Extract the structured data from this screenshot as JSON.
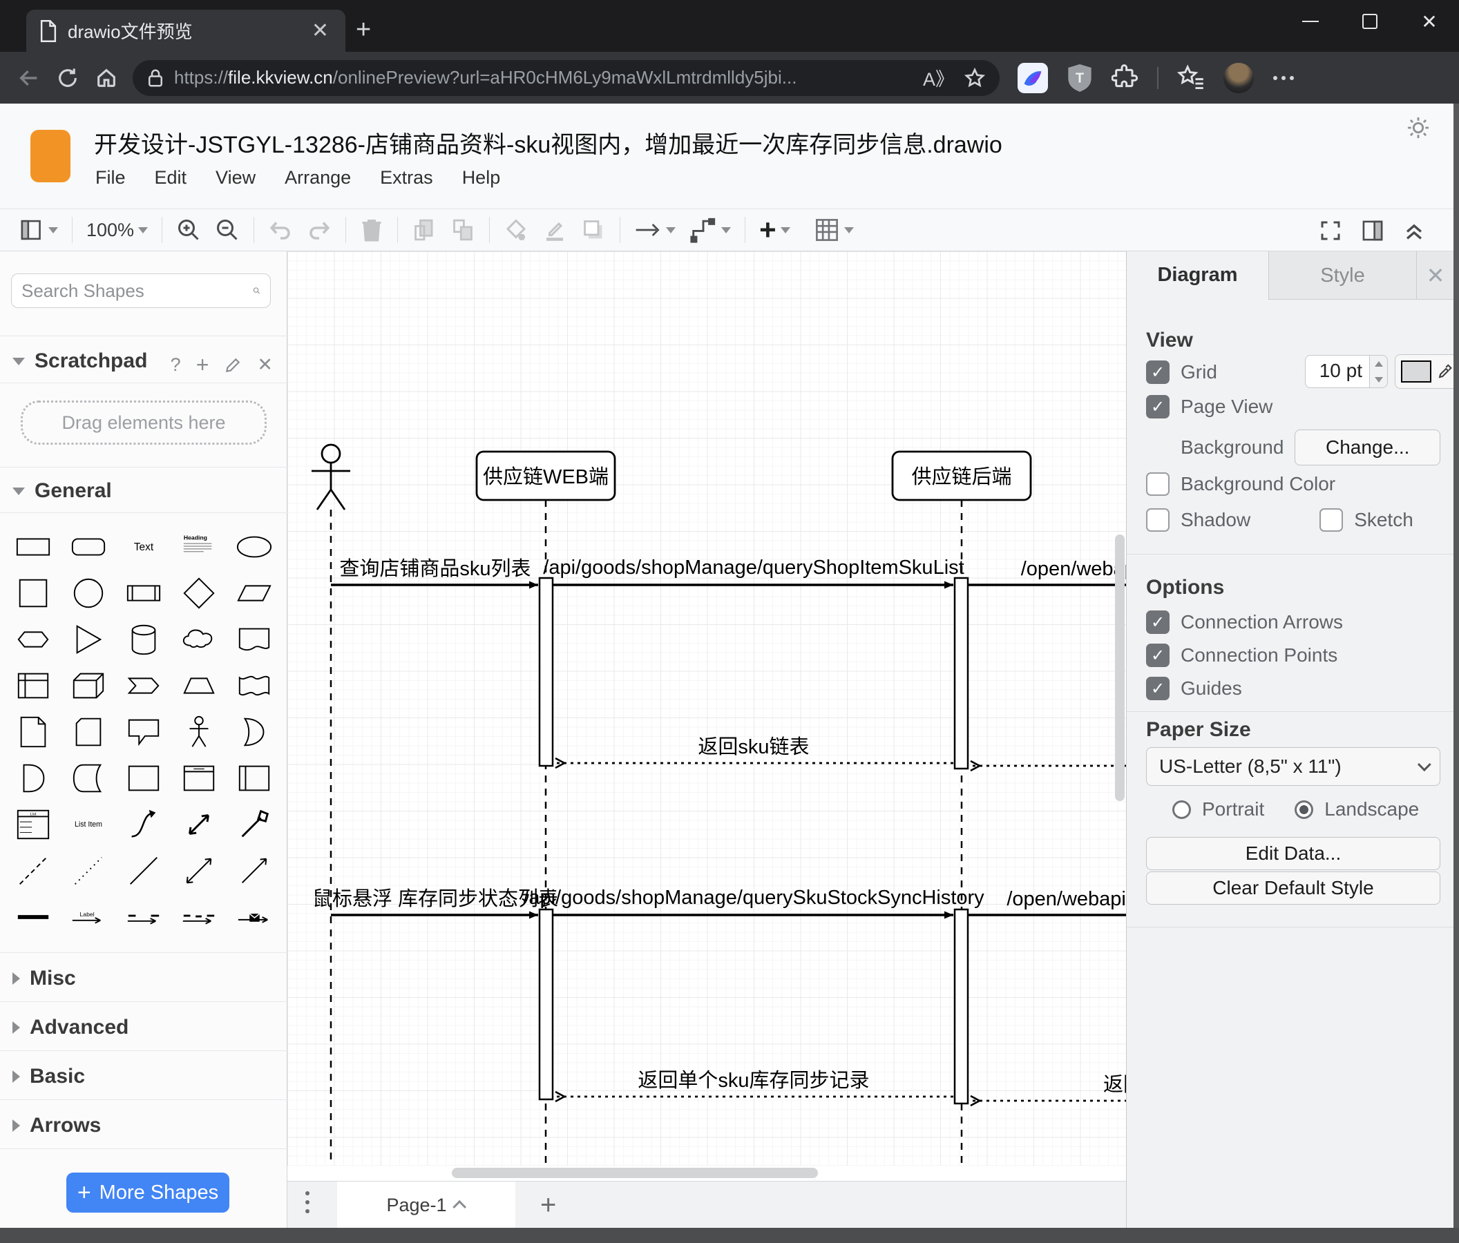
{
  "browser": {
    "tab_title": "drawio文件预览",
    "url": {
      "scheme": "https://",
      "host": "file.kkview.cn",
      "path": "/onlinePreview?url=aHR0cHM6Ly9maWxlLmtrdmlldy5jbi..."
    },
    "read_aloud": "A》"
  },
  "app": {
    "title": "开发设计-JSTGYL-13286-店铺商品资料-sku视图内，增加最近一次库存同步信息.drawio",
    "menu": [
      "File",
      "Edit",
      "View",
      "Arrange",
      "Extras",
      "Help"
    ],
    "zoom_level": "100%"
  },
  "sidebar": {
    "search_placeholder": "Search Shapes",
    "scratchpad": {
      "title": "Scratchpad",
      "hint": "Drag elements here"
    },
    "sections": {
      "general": "General",
      "misc": "Misc",
      "advanced": "Advanced",
      "basic": "Basic",
      "arrows": "Arrows"
    },
    "palette_text": {
      "text": "Text",
      "heading": "Heading",
      "list": "List",
      "list_item": "List Item",
      "label": "Label"
    },
    "shapes": [
      "rectangle",
      "rounded-rectangle",
      "text",
      "textbox",
      "ellipse",
      "square",
      "circle",
      "process",
      "diamond",
      "parallelogram",
      "hexagon",
      "triangle",
      "cylinder",
      "cloud",
      "document",
      "internal-storage",
      "cube",
      "step",
      "trapezoid",
      "tape",
      "note",
      "card",
      "callout",
      "actor",
      "or",
      "and",
      "data-storage",
      "container",
      "container-titled",
      "vertical-container",
      "list",
      "list-item",
      "curve",
      "bidirectional-arrow",
      "arrow",
      "dashed-line",
      "dotted-line",
      "line",
      "bidirectional-connector",
      "directional-connector",
      "link",
      "arrow-label",
      "arrow-source-target",
      "arrow-source-target-2",
      "envelope-arrow"
    ],
    "more_shapes": "More Shapes"
  },
  "canvas": {
    "participants": [
      {
        "label": "供应链WEB端"
      },
      {
        "label": "供应链后端"
      }
    ],
    "messages": [
      {
        "label": "查询店铺商品sku列表"
      },
      {
        "label": "/api/goods/shopManage/queryShopItemSkuList"
      },
      {
        "label": "/open/webapi/"
      },
      {
        "label": "返回sku链表"
      },
      {
        "label": "鼠标悬浮 库存同步状态列表"
      },
      {
        "label": "/api/goods/shopManage/querySkuStockSyncHistory"
      },
      {
        "label": "/open/webapi/iten"
      },
      {
        "label": "返回单个sku库存同步记录"
      },
      {
        "label": "返回"
      }
    ]
  },
  "panel": {
    "tabs": {
      "diagram": "Diagram",
      "style": "Style"
    },
    "view": {
      "title": "View",
      "grid": "Grid",
      "grid_size": "10 pt",
      "page_view": "Page View",
      "background": "Background",
      "change": "Change...",
      "background_color": "Background Color",
      "shadow": "Shadow",
      "sketch": "Sketch",
      "grid_color": "#d9dadb"
    },
    "options": {
      "title": "Options",
      "items": [
        "Connection Arrows",
        "Connection Points",
        "Guides"
      ]
    },
    "paper": {
      "title": "Paper Size",
      "value": "US-Letter (8,5\" x 11\")",
      "portrait": "Portrait",
      "landscape": "Landscape"
    },
    "buttons": {
      "edit_data": "Edit Data...",
      "clear_default_style": "Clear Default Style"
    }
  },
  "footer": {
    "page": "Page-1"
  },
  "colors": {
    "accent_blue": "#4285f4",
    "logo_orange": "#f19425"
  }
}
